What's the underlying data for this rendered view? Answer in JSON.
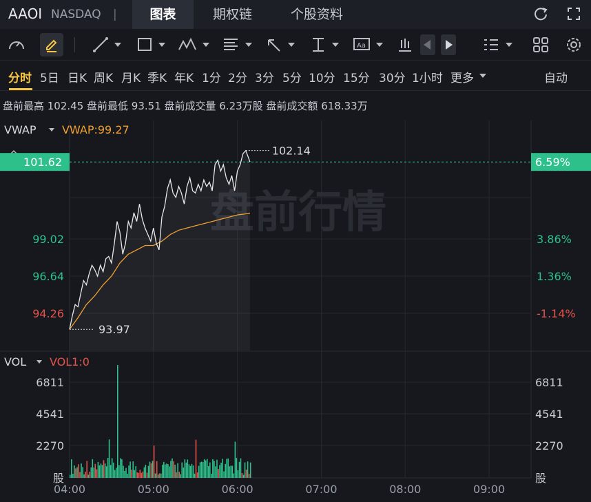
{
  "header": {
    "symbol": "AAOI",
    "exchange": "NASDAQ",
    "separator": "|",
    "tabs": [
      {
        "label": "图表",
        "active": true
      },
      {
        "label": "期权链",
        "active": false
      },
      {
        "label": "个股资料",
        "active": false
      }
    ]
  },
  "toolbar": {
    "icons": [
      "gauge-icon",
      "pen-icon",
      "line-tool-icon",
      "rectangle-tool-icon",
      "pattern-tool-icon",
      "fib-tool-icon",
      "arrow-tool-icon",
      "measure-tool-icon",
      "text-tool-icon",
      "candle-type-icon",
      "prev-icon",
      "next-icon",
      "layout-list-icon",
      "grid-layout-icon",
      "settings-icon"
    ]
  },
  "periods": {
    "items": [
      "分时",
      "5日",
      "日K",
      "周K",
      "月K",
      "季K",
      "年K",
      "1分",
      "2分",
      "3分",
      "5分",
      "10分",
      "15分",
      "30分",
      "1小时",
      "更多"
    ],
    "active": "分时",
    "auto": "自动"
  },
  "stats": {
    "text": "盘前最高 102.45  盘前最低 93.51  盘前成交量 6.23万股  盘前成交额 618.33万"
  },
  "price_panel": {
    "indicator": "VWAP",
    "indicator_value": "VWAP:99.27",
    "current_price": "101.62",
    "current_pct": "6.59%",
    "y_labels": [
      {
        "v": "99.02",
        "pct": "3.86%",
        "color": "#2ec08b"
      },
      {
        "v": "96.64",
        "pct": "1.36%",
        "color": "#2ec08b"
      },
      {
        "v": "94.26",
        "pct": "-1.14%",
        "color": "#e5534b"
      }
    ],
    "high_marker": "102.14",
    "low_marker": "93.97",
    "watermark": "盘前行情"
  },
  "vol_panel": {
    "indicator": "VOL",
    "indicator_value": "VOL1:0",
    "y_labels": [
      "6811",
      "4541",
      "2270"
    ],
    "unit": "股"
  },
  "x_labels": [
    "04:00",
    "05:00",
    "06:00",
    "07:00",
    "08:00",
    "09:00"
  ],
  "colors": {
    "up": "#2ec08b",
    "down": "#e5534b",
    "vwap": "#f0a030",
    "price_line": "#e8e8e8",
    "accent": "#f7c544"
  },
  "chart_data": {
    "type": "line",
    "x_range": [
      "04:00",
      "09:30"
    ],
    "y_range": [
      93.0,
      103.2
    ],
    "price": [
      [
        0,
        93.97
      ],
      [
        2,
        94.6
      ],
      [
        4,
        95.1
      ],
      [
        6,
        95.0
      ],
      [
        8,
        95.6
      ],
      [
        10,
        96.2
      ],
      [
        12,
        96.0
      ],
      [
        14,
        96.5
      ],
      [
        16,
        96.9
      ],
      [
        18,
        96.7
      ],
      [
        20,
        96.4
      ],
      [
        22,
        96.9
      ],
      [
        24,
        96.6
      ],
      [
        26,
        97.2
      ],
      [
        28,
        97.3
      ],
      [
        30,
        97.0
      ],
      [
        32,
        97.9
      ],
      [
        34,
        98.9
      ],
      [
        36,
        98.4
      ],
      [
        38,
        97.4
      ],
      [
        40,
        97.9
      ],
      [
        42,
        98.9
      ],
      [
        44,
        98.6
      ],
      [
        46,
        99.3
      ],
      [
        48,
        98.9
      ],
      [
        50,
        99.7
      ],
      [
        52,
        99.0
      ],
      [
        54,
        98.6
      ],
      [
        56,
        98.3
      ],
      [
        58,
        98.0
      ],
      [
        60,
        98.6
      ],
      [
        62,
        97.9
      ],
      [
        64,
        97.6
      ],
      [
        66,
        99.1
      ],
      [
        68,
        99.6
      ],
      [
        70,
        100.4
      ],
      [
        72,
        100.8
      ],
      [
        74,
        100.2
      ],
      [
        76,
        100.0
      ],
      [
        78,
        100.5
      ],
      [
        80,
        100.2
      ],
      [
        82,
        99.7
      ],
      [
        84,
        100.5
      ],
      [
        86,
        100.9
      ],
      [
        88,
        100.3
      ],
      [
        90,
        100.2
      ],
      [
        92,
        100.6
      ],
      [
        94,
        100.3
      ],
      [
        96,
        100.8
      ],
      [
        98,
        100.5
      ],
      [
        100,
        100.7
      ],
      [
        102,
        100.3
      ],
      [
        104,
        101.5
      ],
      [
        106,
        101.7
      ],
      [
        108,
        101.2
      ],
      [
        110,
        101.5
      ],
      [
        112,
        100.9
      ],
      [
        114,
        100.6
      ],
      [
        116,
        101.0
      ],
      [
        118,
        100.3
      ],
      [
        120,
        101.2
      ],
      [
        122,
        101.5
      ],
      [
        124,
        102.0
      ],
      [
        126,
        102.14
      ],
      [
        128,
        101.8
      ],
      [
        129,
        101.62
      ]
    ],
    "vwap": [
      [
        0,
        93.97
      ],
      [
        6,
        94.5
      ],
      [
        12,
        95.1
      ],
      [
        18,
        95.5
      ],
      [
        24,
        96.0
      ],
      [
        30,
        96.4
      ],
      [
        36,
        97.0
      ],
      [
        42,
        97.4
      ],
      [
        48,
        97.6
      ],
      [
        54,
        97.8
      ],
      [
        60,
        97.8
      ],
      [
        66,
        98.0
      ],
      [
        72,
        98.3
      ],
      [
        78,
        98.5
      ],
      [
        84,
        98.6
      ],
      [
        90,
        98.7
      ],
      [
        96,
        98.8
      ],
      [
        102,
        98.9
      ],
      [
        108,
        99.0
      ],
      [
        114,
        99.1
      ],
      [
        120,
        99.2
      ],
      [
        129,
        99.27
      ]
    ],
    "volume_max": 7800
  }
}
